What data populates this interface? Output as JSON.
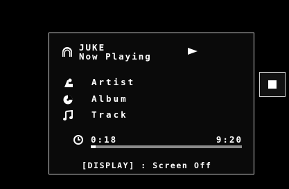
{
  "source": {
    "name": "JUKE",
    "status": "Now Playing"
  },
  "playback": {
    "state_icon": "play-icon",
    "elapsed": "0:18",
    "total": "9:20",
    "progress": 0.032
  },
  "info": {
    "artist_label": "Artist",
    "album_label": "Album",
    "track_label": "Track"
  },
  "footer": {
    "hint": "[DISPLAY] : Screen Off"
  },
  "side": {
    "stop_icon": "stop-icon"
  },
  "colors": {
    "background": "#000000",
    "text": "#ffffff",
    "border": "#cfcfcf",
    "progress_track": "#8a8a8a"
  }
}
